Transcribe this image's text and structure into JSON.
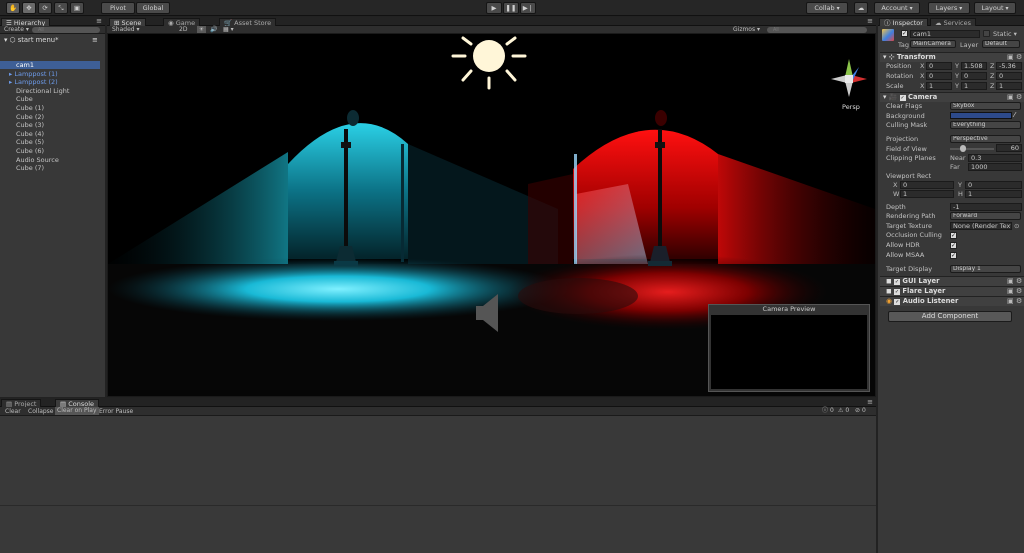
{
  "toolbar": {
    "tools": [
      "hand-tool",
      "move-tool",
      "rotate-tool",
      "scale-tool",
      "rect-tool"
    ],
    "pivot": "Pivot",
    "global": "Global",
    "collab": "Collab",
    "account": "Account",
    "layers": "Layers",
    "layout": "Layout"
  },
  "hierarchy": {
    "tab": "Hierarchy",
    "create": "Create",
    "search_placeholder": "All",
    "scene": "start menu*",
    "items": [
      {
        "label": "cam1",
        "type": "selected"
      },
      {
        "label": "Lamppost (1)",
        "type": "prefab"
      },
      {
        "label": "Lamppost (2)",
        "type": "prefab"
      },
      {
        "label": "Directional Light",
        "type": "normal"
      },
      {
        "label": "Cube",
        "type": "normal"
      },
      {
        "label": "Cube (1)",
        "type": "normal"
      },
      {
        "label": "Cube (2)",
        "type": "normal"
      },
      {
        "label": "Cube (3)",
        "type": "normal"
      },
      {
        "label": "Cube (4)",
        "type": "normal"
      },
      {
        "label": "Cube (5)",
        "type": "normal"
      },
      {
        "label": "Cube (6)",
        "type": "normal"
      },
      {
        "label": "Audio Source",
        "type": "normal"
      },
      {
        "label": "Cube (7)",
        "type": "normal"
      }
    ]
  },
  "scene_view": {
    "tabs": [
      "Scene",
      "Game",
      "Asset Store"
    ],
    "shading": "Shaded",
    "mode_2d": "2D",
    "gizmos": "Gizmos",
    "search_placeholder": "All",
    "persp": "Persp",
    "camera_preview": "Camera Preview"
  },
  "bottom": {
    "tabs": [
      "Project",
      "Console"
    ],
    "buttons": [
      "Clear",
      "Collapse",
      "Clear on Play",
      "Error Pause"
    ],
    "counts": [
      "0",
      "0",
      "0"
    ]
  },
  "inspector": {
    "tabs": [
      "Inspector",
      "Services"
    ],
    "object_name": "cam1",
    "static": "Static",
    "tag_label": "Tag",
    "tag": "MainCamera",
    "layer_label": "Layer",
    "layer": "Default",
    "transform": {
      "title": "Transform",
      "position_label": "Position",
      "position": {
        "x": "0",
        "y": "1.508",
        "z": "-5.36"
      },
      "rotation_label": "Rotation",
      "rotation": {
        "x": "0",
        "y": "0",
        "z": "0"
      },
      "scale_label": "Scale",
      "scale": {
        "x": "1",
        "y": "1",
        "z": "1"
      }
    },
    "camera": {
      "title": "Camera",
      "clear_flags_label": "Clear Flags",
      "clear_flags": "Skybox",
      "background_label": "Background",
      "background_color": "#2d4a8a",
      "culling_mask_label": "Culling Mask",
      "culling_mask": "Everything",
      "projection_label": "Projection",
      "projection": "Perspective",
      "fov_label": "Field of View",
      "fov": "60",
      "clipping_label": "Clipping Planes",
      "near_label": "Near",
      "near": "0.3",
      "far_label": "Far",
      "far": "1000",
      "viewport_label": "Viewport Rect",
      "vx": "0",
      "vy": "0",
      "vw": "1",
      "vh": "1",
      "depth_label": "Depth",
      "depth": "-1",
      "rendering_path_label": "Rendering Path",
      "rendering_path": "Forward",
      "target_texture_label": "Target Texture",
      "target_texture": "None (Render Text",
      "occlusion_label": "Occlusion Culling",
      "hdr_label": "Allow HDR",
      "msaa_label": "Allow MSAA",
      "target_display_label": "Target Display",
      "target_display": "Display 1"
    },
    "components": [
      "GUI Layer",
      "Flare Layer",
      "Audio Listener"
    ],
    "add_component": "Add Component"
  },
  "axis_labels": {
    "x": "X",
    "y": "Y",
    "z": "Z",
    "w": "W",
    "h": "H"
  }
}
